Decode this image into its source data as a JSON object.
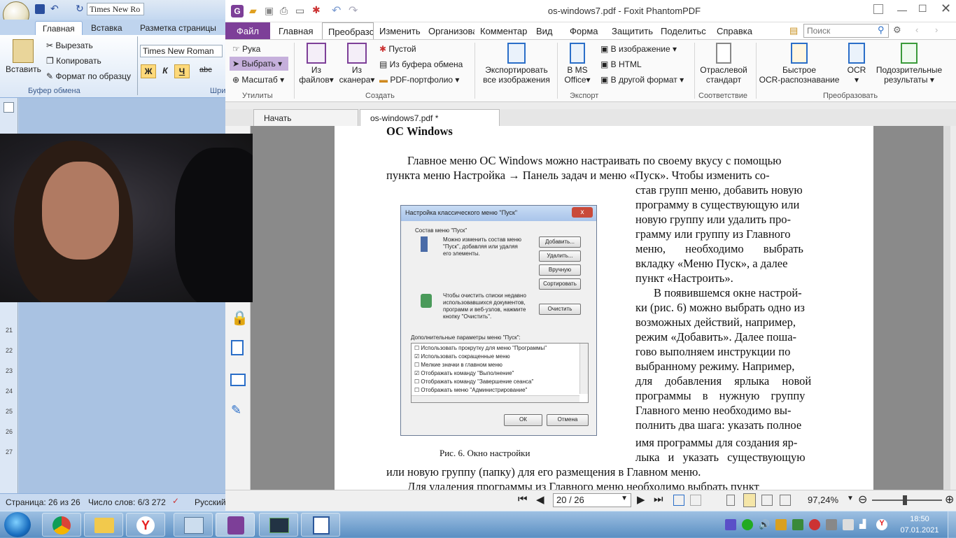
{
  "word": {
    "font_name_qat": "Times New Ro",
    "tabs": [
      "Главная",
      "Вставка",
      "Разметка страницы"
    ],
    "paste_label": "Вставить",
    "clipboard_items": [
      "Вырезать",
      "Копировать",
      "Формат по образцу"
    ],
    "clipboard_group": "Буфер обмена",
    "font_box": "Times New Roman",
    "font_group_partial": "Шри",
    "format_buttons": [
      "Ж",
      "К",
      "Ч",
      "abc"
    ],
    "ruler_numbers": [
      "21",
      "22",
      "23",
      "24",
      "25",
      "26",
      "27"
    ],
    "status": {
      "page": "Страница: 26 из 26",
      "words": "Число слов: 6/3 272",
      "lang": "Русский"
    }
  },
  "foxit": {
    "title": "os-windows7.pdf - Foxit PhantomPDF",
    "tabs": [
      "Файл",
      "Главная",
      "Преобразо",
      "Изменить",
      "Организова",
      "Комментар",
      "Вид",
      "Форма",
      "Защитить",
      "Поделитьс",
      "Справка"
    ],
    "search_placeholder": "Поиск",
    "ribbon": {
      "utilities": {
        "hand": "Рука",
        "select": "Выбрать",
        "zoom": "Масштаб",
        "group": "Утилиты"
      },
      "create": {
        "from_files_1": "Из",
        "from_files_2": "файлов",
        "from_scanner_1": "Из",
        "from_scanner_2": "сканера",
        "blank": "Пустой",
        "from_clipboard": "Из буфера обмена",
        "portfolio": "PDF-портфолио",
        "group": "Создать"
      },
      "export": {
        "export_images_1": "Экспортировать",
        "export_images_2": "все изображения",
        "ms_office_1": "В MS",
        "ms_office_2": "Office",
        "to_image": "В изображение",
        "to_html": "В HTML",
        "to_other": "В другой формат",
        "group": "Экспорт"
      },
      "compliance": {
        "industry_1": "Отраслевой",
        "industry_2": "стандарт",
        "group": "Соответствие"
      },
      "convert": {
        "quick_ocr_1": "Быстрое",
        "quick_ocr_2": "OCR-распознавание",
        "ocr": "OCR",
        "suspicious_1": "Подозрительные",
        "suspicious_2": "результаты",
        "group": "Преобразовать"
      }
    },
    "doc_tabs": [
      "Начать",
      "os-windows7.pdf *"
    ],
    "page": {
      "heading": "ОС Windows",
      "lines": [
        "Главное меню ОС Windows можно настраивать по своему вкусу с помощью",
        "пункта меню Настройка → Панель задач и меню «Пуск». Чтобы изменить со-",
        "став групп меню, добавить новую",
        "программу в существующую или",
        "новую группу или удалить про-",
        "грамму или группу из Главного",
        "меню, необходимо выбрать",
        "вкладку «Меню Пуск», а далее",
        "пункт «Настроить».",
        "В появившемся окне настрой-",
        "ки (рис. 6) можно выбрать одно из",
        "возможных действий, например,",
        "режим «Добавить». Далее поша-",
        "гово выполняем инструкции по",
        "выбранному режиму. Например,",
        "для добавления ярлыка новой",
        "программы в нужную группу",
        "Главного меню необходимо вы-",
        "полнить два шага: указать полное",
        "имя программы для создания яр-",
        "лыка и указать существующую",
        "или новую группу (папку) для его размещения в Главном меню.",
        "Для удаления программы из Главного меню необходимо выбрать пункт"
      ],
      "caption": "Рис. 6. Окно настройки"
    },
    "dialog": {
      "title": "Настройка классического меню \"Пуск\"",
      "section1": "Состав меню \"Пуск\"",
      "desc1": [
        "Можно изменить состав меню",
        "\"Пуск\", добавляя или удаляя",
        "его элементы."
      ],
      "buttons": [
        "Добавить...",
        "Удалить...",
        "Вручную",
        "Сортировать"
      ],
      "desc2": [
        "Чтобы очистить списки недавно",
        "использовавшихся документов,",
        "программ и веб-узлов, нажмите",
        "кнопку \"Очистить\"."
      ],
      "clear": "Очистить",
      "section2": "Дополнительные параметры меню \"Пуск\":",
      "options": [
        {
          "label": "Использовать прокрутку для меню \"Программы\"",
          "checked": false
        },
        {
          "label": "Использовать сокращенные меню",
          "checked": true
        },
        {
          "label": "Мелкие значки в главном меню",
          "checked": false
        },
        {
          "label": "Отображать команду \"Выполнение\"",
          "checked": true
        },
        {
          "label": "Отображать команду \"Завершение сеанса\"",
          "checked": false
        },
        {
          "label": "Отображать меню \"Администрирование\"",
          "checked": false
        }
      ],
      "ok": "ОК",
      "cancel": "Отмена"
    },
    "status": {
      "page_box": "20 / 26",
      "zoom": "97,24%"
    }
  },
  "taskbar": {
    "time": "18:50",
    "date": "07.01.2021"
  },
  "colors": {
    "foxit_accent": "#7d3f98",
    "word_blue": "#bcd3ee",
    "taskbar": "#5b8fc3"
  }
}
